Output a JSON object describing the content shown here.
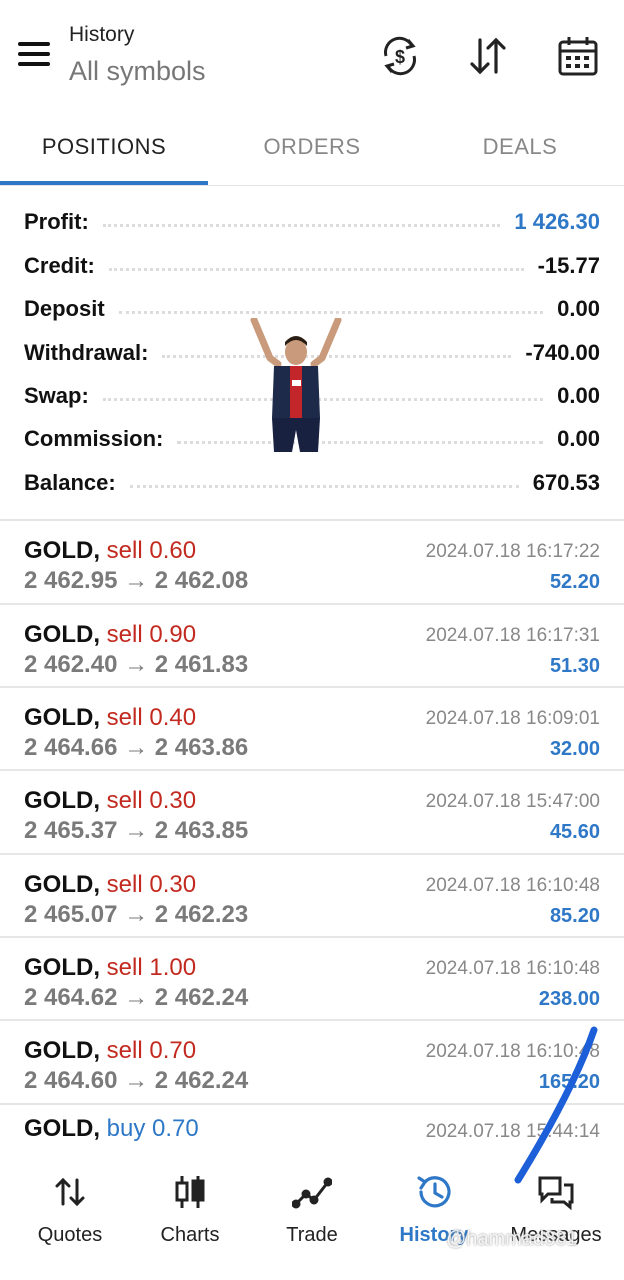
{
  "header": {
    "title": "History",
    "subtitle": "All symbols",
    "icons": [
      "menu-icon",
      "currency-exchange-icon",
      "sort-icon",
      "calendar-icon"
    ]
  },
  "tabs": [
    {
      "label": "POSITIONS",
      "active": true
    },
    {
      "label": "ORDERS",
      "active": false
    },
    {
      "label": "DEALS",
      "active": false
    }
  ],
  "summary": [
    {
      "label": "Profit:",
      "value": "1 426.30"
    },
    {
      "label": "Credit:",
      "value": "-15.77"
    },
    {
      "label": "Deposit",
      "value": "0.00"
    },
    {
      "label": "Withdrawal:",
      "value": "-740.00"
    },
    {
      "label": "Swap:",
      "value": "0.00"
    },
    {
      "label": "Commission:",
      "value": "0.00"
    },
    {
      "label": "Balance:",
      "value": "670.53"
    }
  ],
  "trades": [
    {
      "symbol": "GOLD,",
      "side": "sell 0.60",
      "prices": "2 462.95 → 2 462.08",
      "time": "2024.07.18 16:17:22",
      "profit": "52.20"
    },
    {
      "symbol": "GOLD,",
      "side": "sell 0.90",
      "prices": "2 462.40 → 2 461.83",
      "time": "2024.07.18 16:17:31",
      "profit": "51.30"
    },
    {
      "symbol": "GOLD,",
      "side": "sell 0.40",
      "prices": "2 464.66 → 2 463.86",
      "time": "2024.07.18 16:09:01",
      "profit": "32.00"
    },
    {
      "symbol": "GOLD,",
      "side": "sell 0.30",
      "prices": "2 465.37 → 2 463.85",
      "time": "2024.07.18 15:47:00",
      "profit": "45.60"
    },
    {
      "symbol": "GOLD,",
      "side": "sell 0.30",
      "prices": "2 465.07 → 2 462.23",
      "time": "2024.07.18 16:10:48",
      "profit": "85.20"
    },
    {
      "symbol": "GOLD,",
      "side": "sell 1.00",
      "prices": "2 464.62 → 2 462.24",
      "time": "2024.07.18 16:10:48",
      "profit": "238.00"
    },
    {
      "symbol": "GOLD,",
      "side": "sell 0.70",
      "prices": "2 464.60 → 2 462.24",
      "time": "2024.07.18 16:10:48",
      "profit": "165.20"
    },
    {
      "symbol": "GOLD,",
      "side": "buy 0.70",
      "prices": "",
      "time": "2024.07.18 15:44:14",
      "profit": ""
    }
  ],
  "nav": [
    {
      "label": "Quotes",
      "icon": "quotes-arrows-icon"
    },
    {
      "label": "Charts",
      "icon": "candlestick-icon"
    },
    {
      "label": "Trade",
      "icon": "trade-line-icon"
    },
    {
      "label": "History",
      "icon": "history-clock-icon"
    },
    {
      "label": "Messages",
      "icon": "chat-bubbles-icon"
    }
  ],
  "colors": {
    "accent": "#2e78c7",
    "sell": "#c22a1f",
    "buy": "#2e78c7"
  },
  "watermark": "@hammad881"
}
